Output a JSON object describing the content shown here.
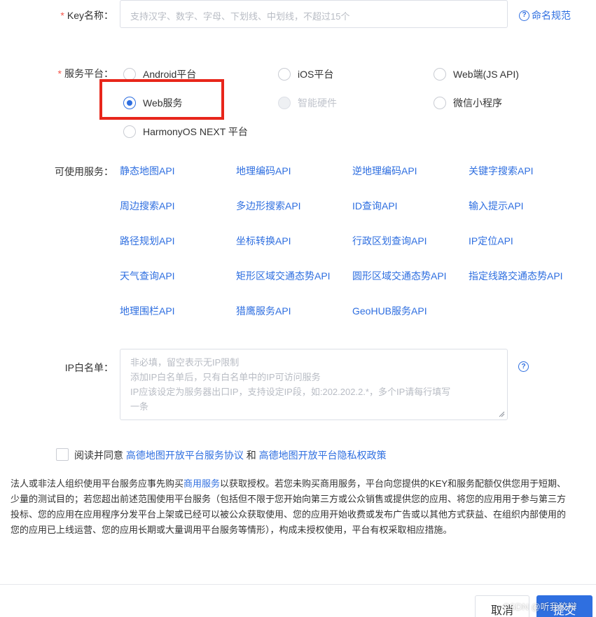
{
  "key_name": {
    "label": "Key名称：",
    "required_mark": "*",
    "placeholder": "支持汉字、数字、字母、下划线、中划线，不超过15个",
    "help_link": "命名规范"
  },
  "platform": {
    "label": "服务平台：",
    "required_mark": "*",
    "options": [
      {
        "label": "Android平台",
        "checked": false,
        "disabled": false
      },
      {
        "label": "iOS平台",
        "checked": false,
        "disabled": false
      },
      {
        "label": "Web端(JS API)",
        "checked": false,
        "disabled": false
      },
      {
        "label": "Web服务",
        "checked": true,
        "disabled": false
      },
      {
        "label": "智能硬件",
        "checked": false,
        "disabled": true
      },
      {
        "label": "微信小程序",
        "checked": false,
        "disabled": false
      },
      {
        "label": "HarmonyOS NEXT 平台",
        "checked": false,
        "disabled": false
      }
    ],
    "highlight_color": "#e8261b"
  },
  "services": {
    "label": "可使用服务：",
    "items": [
      "静态地图API",
      "地理编码API",
      "逆地理编码API",
      "关键字搜索API",
      "周边搜索API",
      "多边形搜索API",
      "ID查询API",
      "输入提示API",
      "路径规划API",
      "坐标转换API",
      "行政区划查询API",
      "IP定位API",
      "天气查询API",
      "矩形区域交通态势API",
      "圆形区域交通态势API",
      "指定线路交通态势API",
      "地理围栏API",
      "猎鹰服务API",
      "GeoHUB服务API"
    ]
  },
  "ip_whitelist": {
    "label": "IP白名单：",
    "placeholder_lines": [
      "非必填，留空表示无IP限制",
      "添加IP白名单后，只有白名单中的IP可访问服务",
      "IP应该设定为服务器出口IP，支持设定IP段，如:202.202.2.*，多个IP请每行填写",
      "一条"
    ]
  },
  "agreement": {
    "prefix": "阅读并同意",
    "link1": "高德地图开放平台服务协议",
    "and": "和",
    "link2": "高德地图开放平台隐私权政策"
  },
  "notice": {
    "part1": "法人或非法人组织使用平台服务应事先购买",
    "link": "商用服务",
    "part2": "以获取授权。若您未购买商用服务，平台向您提供的KEY和服务配额仅供您用于短期、少量的测试目的；若您超出前述范围使用平台服务（包括但不限于您开始向第三方或公众销售或提供您的应用、将您的应用用于参与第三方投标、您的应用在应用程序分发平台上架或已经可以被公众获取使用、您的应用开始收费或发布广告或以其他方式获益、在组织内部使用的您的应用已上线运营、您的应用长期或大量调用平台服务等情形），构成未授权使用，平台有权采取相应措施。"
  },
  "buttons": {
    "cancel": "取消",
    "submit": "提交"
  },
  "watermark": "CSDN @听我狡辩",
  "colors": {
    "accent": "#2f6fe0",
    "required": "#f5554a"
  }
}
